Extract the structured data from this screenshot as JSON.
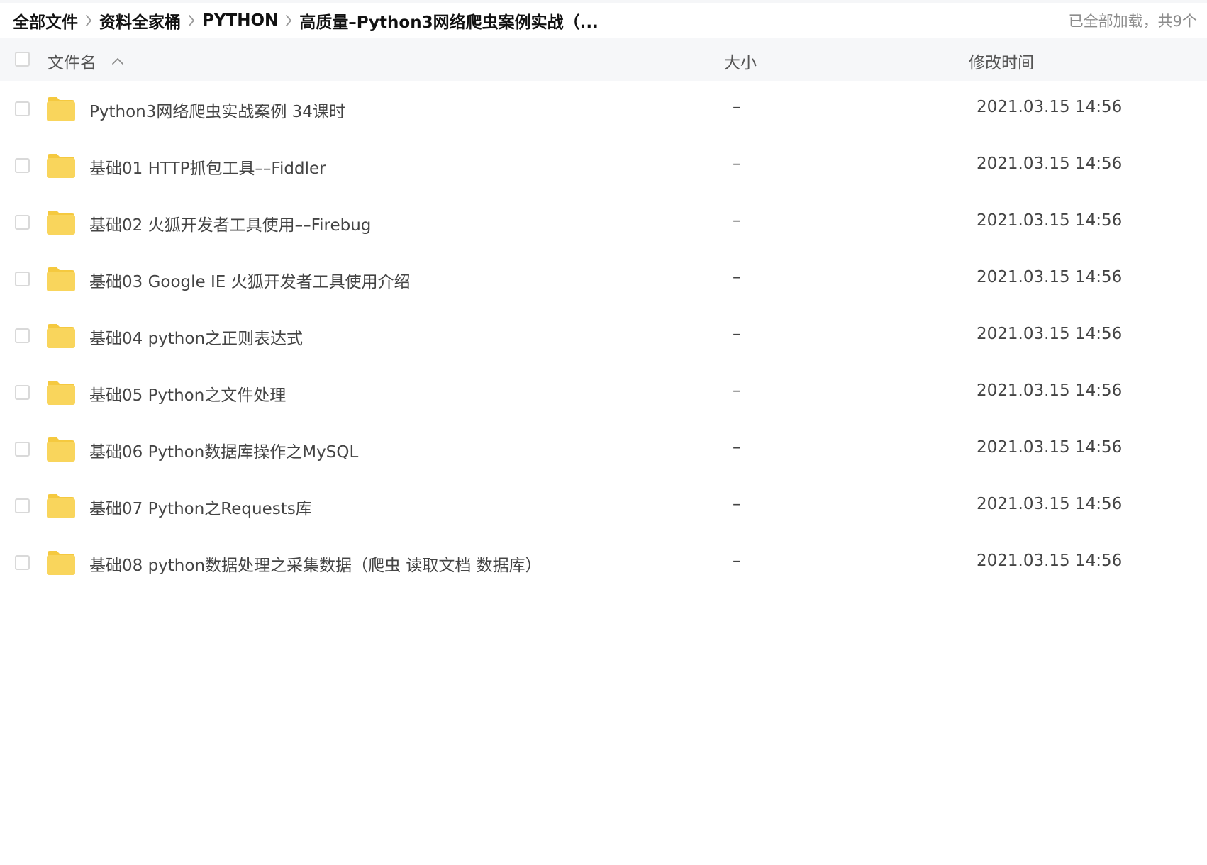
{
  "breadcrumb": {
    "items": [
      "全部文件",
      "资料全家桶",
      "PYTHON"
    ],
    "current": "高质量–Python3网络爬虫案例实战（..."
  },
  "status": {
    "load_text": "已全部加载，共9个"
  },
  "header": {
    "name_label": "文件名",
    "size_label": "大小",
    "mtime_label": "修改时间"
  },
  "files": [
    {
      "name": "Python3网络爬虫实战案例 34课时",
      "size": "–",
      "mtime": "2021.03.15 14:56"
    },
    {
      "name": "基础01 HTTP抓包工具––Fiddler",
      "size": "–",
      "mtime": "2021.03.15 14:56"
    },
    {
      "name": "基础02 火狐开发者工具使用––Firebug",
      "size": "–",
      "mtime": "2021.03.15 14:56"
    },
    {
      "name": "基础03 Google IE 火狐开发者工具使用介绍",
      "size": "–",
      "mtime": "2021.03.15 14:56"
    },
    {
      "name": "基础04 python之正则表达式",
      "size": "–",
      "mtime": "2021.03.15 14:56"
    },
    {
      "name": "基础05 Python之文件处理",
      "size": "–",
      "mtime": "2021.03.15 14:56"
    },
    {
      "name": "基础06 Python数据库操作之MySQL",
      "size": "–",
      "mtime": "2021.03.15 14:56"
    },
    {
      "name": "基础07 Python之Requests库",
      "size": "–",
      "mtime": "2021.03.15 14:56"
    },
    {
      "name": "基础08 python数据处理之采集数据（爬虫 读取文档 数据库）",
      "size": "–",
      "mtime": "2021.03.15 14:56"
    }
  ],
  "icons": {
    "folder": "folder-icon",
    "separator": "chevron-right-icon",
    "sort": "chevron-up-icon"
  },
  "colors": {
    "folder": "#f9d55c",
    "folder_tab": "#f5c93f",
    "header_bg": "#f6f7f9",
    "muted_text": "#8c8c8c"
  }
}
